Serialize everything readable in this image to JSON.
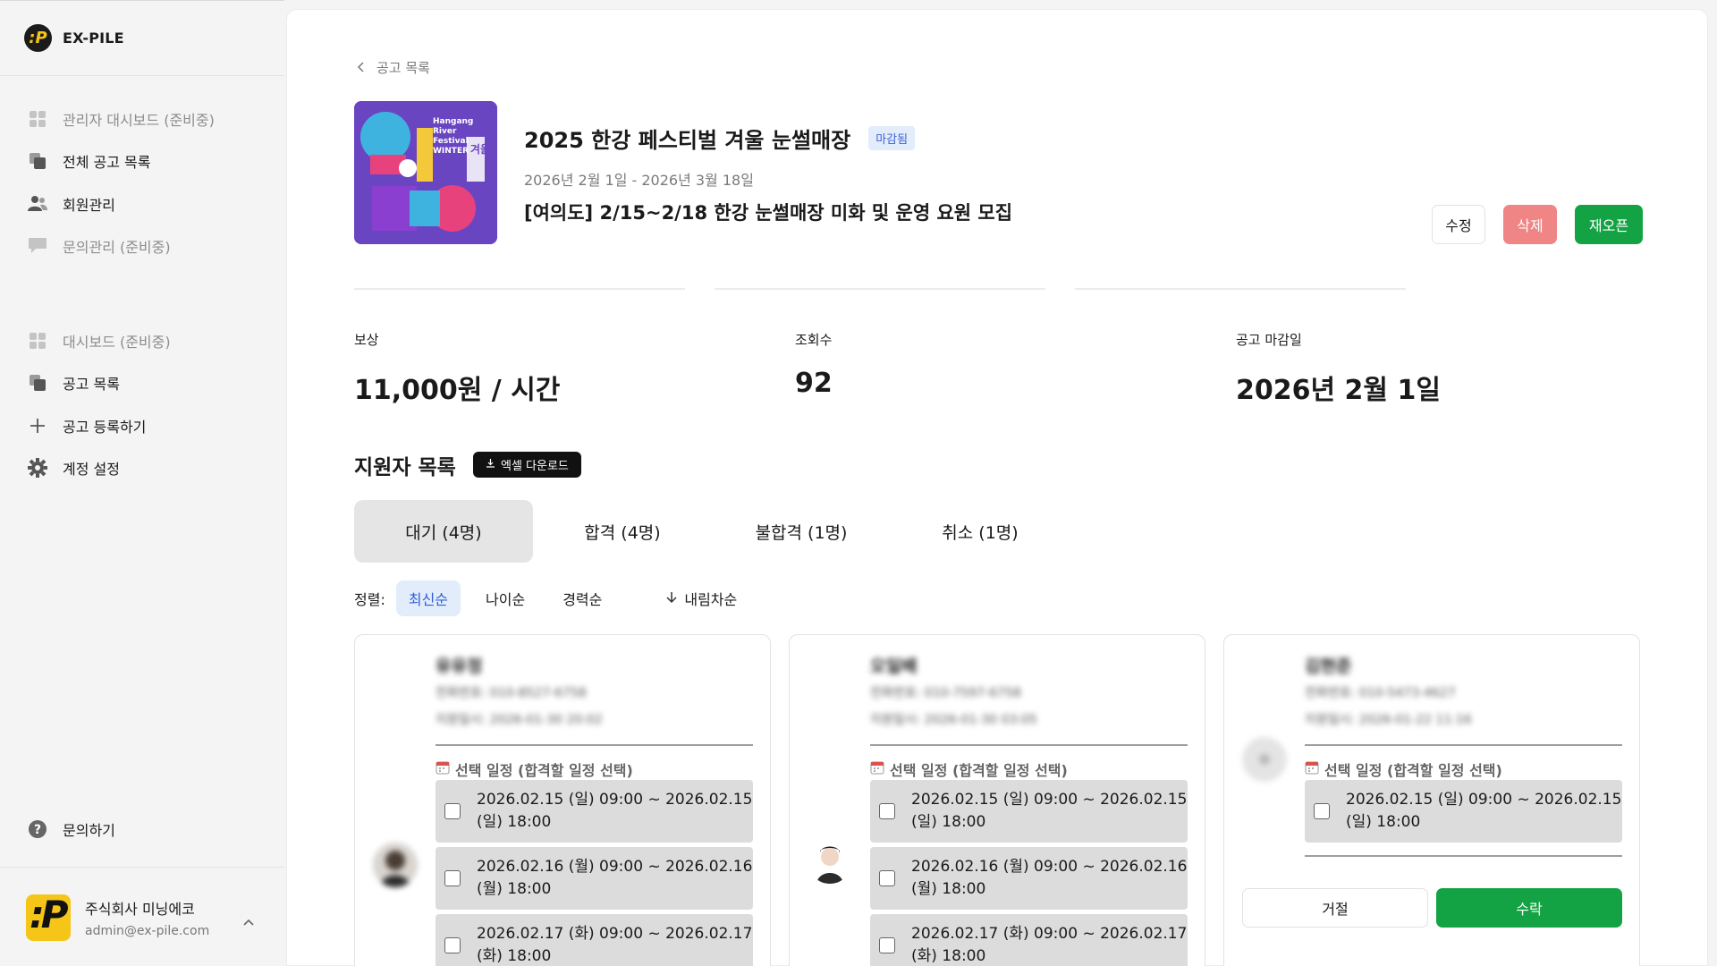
{
  "brand": {
    "name": "EX-PILE",
    "logo_glyph": ":P"
  },
  "sidebar": {
    "admin_items": [
      {
        "label": "관리자 대시보드 (준비중)",
        "icon": "grid-icon",
        "muted": true
      },
      {
        "label": "전체 공고 목록",
        "icon": "copy-icon",
        "muted": false
      },
      {
        "label": "회원관리",
        "icon": "users-icon",
        "muted": false
      },
      {
        "label": "문의관리 (준비중)",
        "icon": "chat-icon",
        "muted": true
      }
    ],
    "items": [
      {
        "label": "대시보드 (준비중)",
        "icon": "grid-icon",
        "muted": true
      },
      {
        "label": "공고 목록",
        "icon": "copy-icon",
        "muted": false
      },
      {
        "label": "공고 등록하기",
        "icon": "plus-icon",
        "muted": false
      },
      {
        "label": "계정 설정",
        "icon": "gear-icon",
        "muted": false
      }
    ],
    "help": {
      "label": "문의하기",
      "icon": "question-icon"
    },
    "account": {
      "org_name": "주식회사 미닝에코",
      "email": "admin@ex-pile.com"
    }
  },
  "posting": {
    "back_label": "공고 목록",
    "title": "2025 한강 페스티벌 겨울 눈썰매장",
    "status": "마감됨",
    "date_range": "2026년 2월 1일 - 2026년 3월 18일",
    "subtitle": "[여의도] 2/15~2/18 한강 눈썰매장 미화 및 운영 요원 모집",
    "poster_text": [
      "Hangang",
      "River",
      "Festival",
      "WINTER",
      "겨울"
    ],
    "actions": {
      "edit": "수정",
      "delete": "삭제",
      "reopen": "재오픈"
    }
  },
  "stats": [
    {
      "label": "보상",
      "value": "11,000원 / 시간"
    },
    {
      "label": "조회수",
      "value": "92"
    },
    {
      "label": "공고 마감일",
      "value": "2026년 2월 1일"
    }
  ],
  "applicants": {
    "section_title": "지원자 목록",
    "excel_button": "엑셀 다운로드",
    "tabs": [
      "대기 (4명)",
      "합격 (4명)",
      "불합격 (1명)",
      "취소 (1명)"
    ],
    "active_tab": 0,
    "sort": {
      "label": "정렬:",
      "options": [
        "최신순",
        "나이순",
        "경력순"
      ],
      "active": 0,
      "order": "내림차순"
    },
    "schedule_heading": "선택 일정 (합격할 일정 선택)",
    "cards": [
      {
        "name": "유유정",
        "phone": "전화번호: 010-8527-6758",
        "applied": "지원일시: 2026-01-30 20:02",
        "slots": [
          "2026.02.15 (일) 09:00 ~ 2026.02.15 (일) 18:00",
          "2026.02.16 (월) 09:00 ~ 2026.02.16 (월) 18:00",
          "2026.02.17 (화) 09:00 ~ 2026.02.17 (화) 18:00"
        ]
      },
      {
        "name": "오일배",
        "phone": "전화번호: 010-7597-6758",
        "applied": "지원일시: 2026-01-30 03:05",
        "slots": [
          "2026.02.15 (일) 09:00 ~ 2026.02.15 (일) 18:00",
          "2026.02.16 (월) 09:00 ~ 2026.02.16 (월) 18:00",
          "2026.02.17 (화) 09:00 ~ 2026.02.17 (화) 18:00"
        ]
      },
      {
        "name": "김현준",
        "phone": "전화번호: 010-5473-4627",
        "applied": "지원일시: 2026-01-22 11:16",
        "slots": [
          "2026.02.15 (일) 09:00 ~ 2026.02.15 (일) 18:00"
        ],
        "reject": "거절",
        "accept": "수락"
      }
    ]
  },
  "colors": {
    "accent_green": "#14a344",
    "delete_red": "#ef8585",
    "badge_blue": "#3d62d9"
  }
}
